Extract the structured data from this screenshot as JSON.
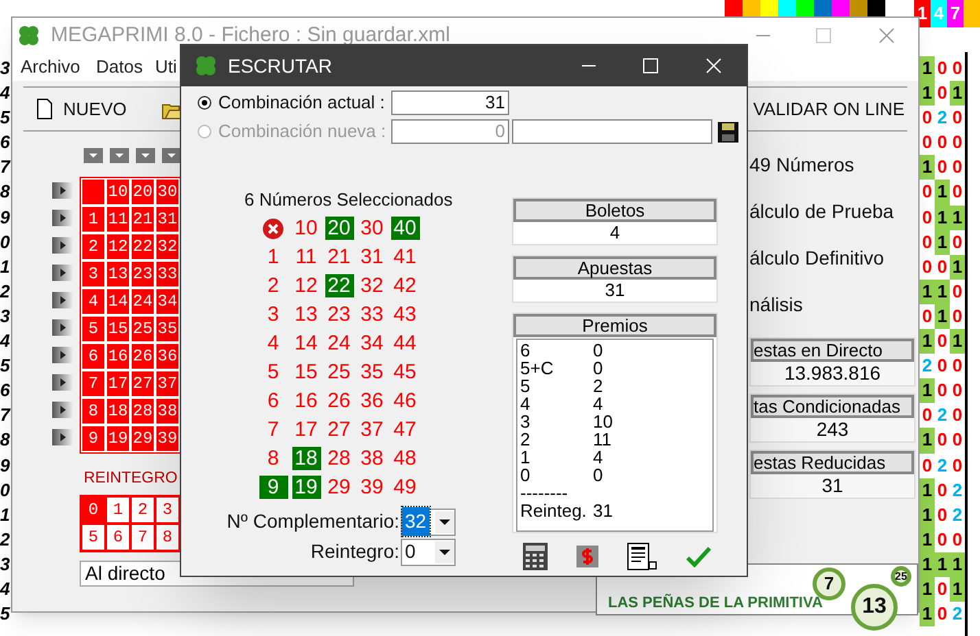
{
  "background": {
    "header_swatches": [
      {
        "color": "#ff0000"
      },
      {
        "color": "#ffc000"
      },
      {
        "color": "#ffff00"
      },
      {
        "color": "#00ffff"
      },
      {
        "color": "#00ff00"
      },
      {
        "color": "#0070c0"
      },
      {
        "color": "#ff00ff"
      },
      {
        "color": "#bf9000"
      },
      {
        "color": "#000000"
      }
    ],
    "corner_cells": [
      {
        "text": "1",
        "color": "#ff0000"
      },
      {
        "text": "4",
        "color": "#00ffff"
      },
      {
        "text": "7",
        "color": "#ff00ff"
      },
      {
        "color": "#ffc000"
      }
    ],
    "row_numbers": [
      "3",
      "4",
      "5",
      "6",
      "7",
      "8",
      "9",
      "0",
      "1",
      "2",
      "3",
      "4",
      "5",
      "6",
      "7",
      "8",
      "9",
      "0",
      "1",
      "2",
      "3",
      "4",
      "5"
    ],
    "grid_rows": [
      [
        {
          "text": "1",
          "kind": "one"
        },
        {
          "text": "0",
          "kind": "zero"
        },
        {
          "text": "0",
          "kind": "zero"
        }
      ],
      [
        {
          "text": "1",
          "kind": "one"
        },
        {
          "text": "0",
          "kind": "zero"
        },
        {
          "text": "1",
          "kind": "one"
        }
      ],
      [
        {
          "text": "0",
          "kind": "zero"
        },
        {
          "text": "2",
          "kind": "two"
        },
        {
          "text": "0",
          "kind": "zero"
        }
      ],
      [
        {
          "text": "0",
          "kind": "zero"
        },
        {
          "text": "0",
          "kind": "zero"
        },
        {
          "text": "0",
          "kind": "zero"
        }
      ],
      [
        {
          "text": "1",
          "kind": "one"
        },
        {
          "text": "0",
          "kind": "zero"
        },
        {
          "text": "0",
          "kind": "zero"
        }
      ],
      [
        {
          "text": "0",
          "kind": "zero"
        },
        {
          "text": "1",
          "kind": "one"
        },
        {
          "text": "0",
          "kind": "zero"
        }
      ],
      [
        {
          "text": "0",
          "kind": "zero"
        },
        {
          "text": "1",
          "kind": "one"
        },
        {
          "text": "1",
          "kind": "one"
        }
      ],
      [
        {
          "text": "0",
          "kind": "zero"
        },
        {
          "text": "1",
          "kind": "one"
        },
        {
          "text": "0",
          "kind": "zero"
        }
      ],
      [
        {
          "text": "0",
          "kind": "zero"
        },
        {
          "text": "0",
          "kind": "zero"
        },
        {
          "text": "1",
          "kind": "one"
        }
      ],
      [
        {
          "text": "1",
          "kind": "one"
        },
        {
          "text": "1",
          "kind": "one"
        },
        {
          "text": "0",
          "kind": "zero"
        }
      ],
      [
        {
          "text": "0",
          "kind": "zero"
        },
        {
          "text": "1",
          "kind": "one"
        },
        {
          "text": "0",
          "kind": "zero"
        }
      ],
      [
        {
          "text": "1",
          "kind": "one"
        },
        {
          "text": "0",
          "kind": "zero"
        },
        {
          "text": "1",
          "kind": "one"
        }
      ],
      [
        {
          "text": "2",
          "kind": "two"
        },
        {
          "text": "0",
          "kind": "zero"
        },
        {
          "text": "0",
          "kind": "zero"
        }
      ],
      [
        {
          "text": "1",
          "kind": "one"
        },
        {
          "text": "0",
          "kind": "zero"
        },
        {
          "text": "0",
          "kind": "zero"
        }
      ],
      [
        {
          "text": "0",
          "kind": "zero"
        },
        {
          "text": "2",
          "kind": "two"
        },
        {
          "text": "0",
          "kind": "zero"
        }
      ],
      [
        {
          "text": "1",
          "kind": "one"
        },
        {
          "text": "0",
          "kind": "zero"
        },
        {
          "text": "0",
          "kind": "zero"
        }
      ],
      [
        {
          "text": "0",
          "kind": "zero"
        },
        {
          "text": "2",
          "kind": "two"
        },
        {
          "text": "0",
          "kind": "zero"
        }
      ],
      [
        {
          "text": "1",
          "kind": "one"
        },
        {
          "text": "0",
          "kind": "zero"
        },
        {
          "text": "2",
          "kind": "two"
        }
      ],
      [
        {
          "text": "1",
          "kind": "one"
        },
        {
          "text": "0",
          "kind": "zero"
        },
        {
          "text": "2",
          "kind": "two"
        }
      ],
      [
        {
          "text": "1",
          "kind": "one"
        },
        {
          "text": "0",
          "kind": "zero"
        },
        {
          "text": "0",
          "kind": "zero"
        }
      ],
      [
        {
          "text": "1",
          "kind": "one"
        },
        {
          "text": "1",
          "kind": "one"
        },
        {
          "text": "1",
          "kind": "one"
        }
      ],
      [
        {
          "text": "1",
          "kind": "one"
        },
        {
          "text": "0",
          "kind": "zero"
        },
        {
          "text": "1",
          "kind": "one"
        }
      ],
      [
        {
          "text": "1",
          "kind": "one"
        },
        {
          "text": "0",
          "kind": "zero"
        },
        {
          "text": "2",
          "kind": "two"
        }
      ]
    ]
  },
  "main_window": {
    "title": "MEGAPRIMI 8.0 - Fichero : Sin guardar.xml",
    "menu": [
      "Archivo",
      "Datos",
      "Uti"
    ],
    "toolbar": [
      {
        "kind": "new",
        "label": "NUEVO"
      },
      {
        "kind": "open"
      }
    ],
    "validate_label": "VALIDAR ON LINE",
    "number_grid": [
      [
        {
          "kind": "empty"
        },
        {
          "kind": "number",
          "text": "10"
        },
        {
          "kind": "number",
          "text": "20"
        },
        {
          "kind": "number",
          "text": "30"
        }
      ],
      [
        {
          "kind": "number",
          "text": "1"
        },
        {
          "kind": "number",
          "text": "11"
        },
        {
          "kind": "number",
          "text": "21"
        },
        {
          "kind": "number",
          "text": "31"
        }
      ],
      [
        {
          "kind": "number",
          "text": "2"
        },
        {
          "kind": "number",
          "text": "12"
        },
        {
          "kind": "number",
          "text": "22"
        },
        {
          "kind": "number",
          "text": "32"
        }
      ],
      [
        {
          "kind": "number",
          "text": "3"
        },
        {
          "kind": "number",
          "text": "13"
        },
        {
          "kind": "number",
          "text": "23"
        },
        {
          "kind": "number",
          "text": "33"
        }
      ],
      [
        {
          "kind": "number",
          "text": "4"
        },
        {
          "kind": "number",
          "text": "14"
        },
        {
          "kind": "number",
          "text": "24"
        },
        {
          "kind": "number",
          "text": "34"
        }
      ],
      [
        {
          "kind": "number",
          "text": "5"
        },
        {
          "kind": "number",
          "text": "15"
        },
        {
          "kind": "number",
          "text": "25"
        },
        {
          "kind": "number",
          "text": "35"
        }
      ],
      [
        {
          "kind": "number",
          "text": "6"
        },
        {
          "kind": "number",
          "text": "16"
        },
        {
          "kind": "number",
          "text": "26"
        },
        {
          "kind": "number",
          "text": "36"
        }
      ],
      [
        {
          "kind": "number",
          "text": "7"
        },
        {
          "kind": "number",
          "text": "17"
        },
        {
          "kind": "number",
          "text": "27"
        },
        {
          "kind": "number",
          "text": "37"
        }
      ],
      [
        {
          "kind": "number",
          "text": "8"
        },
        {
          "kind": "number",
          "text": "18"
        },
        {
          "kind": "number",
          "text": "28"
        },
        {
          "kind": "number",
          "text": "38"
        }
      ],
      [
        {
          "kind": "number",
          "text": "9"
        },
        {
          "kind": "number",
          "text": "19"
        },
        {
          "kind": "number",
          "text": "29"
        },
        {
          "kind": "number",
          "text": "39"
        }
      ]
    ],
    "reintegro": {
      "label": "REINTEGRO",
      "rows": [
        [
          {
            "text": "0",
            "selected": true
          },
          {
            "text": "1",
            "selected": false
          },
          {
            "text": "2",
            "selected": false
          },
          {
            "text": "3",
            "selected": false
          }
        ],
        [
          {
            "text": "5",
            "selected": false
          },
          {
            "text": "6",
            "selected": false
          },
          {
            "text": "7",
            "selected": false
          },
          {
            "text": "8",
            "selected": false
          }
        ]
      ]
    },
    "mode_select": "Al directo",
    "actions": [
      "49 Números",
      "álculo de Prueba",
      "álculo Definitivo",
      "nálisis"
    ],
    "stat_boxes": [
      {
        "label": "estas en Directo",
        "value": "13.983.816"
      },
      {
        "label": "tas Condicionadas",
        "value": "243"
      },
      {
        "label": "estas Reducidas",
        "value": "31"
      }
    ],
    "banner": {
      "tagline": "LAS PEÑAS DE LA PRIMITIVA",
      "balls": [
        "7",
        "13",
        "25"
      ]
    }
  },
  "dialog": {
    "title": "ESCRUTAR",
    "combination_options": [
      {
        "label": "Combinación actual :",
        "selected": true,
        "disabled": false,
        "value": "31"
      },
      {
        "label": "Combinación nueva :",
        "selected": false,
        "disabled": true,
        "value": "0"
      }
    ],
    "heading": "6 Números Seleccionados",
    "numbers": [
      [
        {
          "kind": "clear"
        },
        {
          "kind": "number",
          "text": "10",
          "selected": false
        },
        {
          "kind": "number",
          "text": "20",
          "selected": true
        },
        {
          "kind": "number",
          "text": "30",
          "selected": false
        },
        {
          "kind": "number",
          "text": "40",
          "selected": true
        }
      ],
      [
        {
          "kind": "number",
          "text": "1",
          "selected": false
        },
        {
          "kind": "number",
          "text": "11",
          "selected": false
        },
        {
          "kind": "number",
          "text": "21",
          "selected": false
        },
        {
          "kind": "number",
          "text": "31",
          "selected": false
        },
        {
          "kind": "number",
          "text": "41",
          "selected": false
        }
      ],
      [
        {
          "kind": "number",
          "text": "2",
          "selected": false
        },
        {
          "kind": "number",
          "text": "12",
          "selected": false
        },
        {
          "kind": "number",
          "text": "22",
          "selected": true
        },
        {
          "kind": "number",
          "text": "32",
          "selected": false
        },
        {
          "kind": "number",
          "text": "42",
          "selected": false
        }
      ],
      [
        {
          "kind": "number",
          "text": "3",
          "selected": false
        },
        {
          "kind": "number",
          "text": "13",
          "selected": false
        },
        {
          "kind": "number",
          "text": "23",
          "selected": false
        },
        {
          "kind": "number",
          "text": "33",
          "selected": false
        },
        {
          "kind": "number",
          "text": "43",
          "selected": false
        }
      ],
      [
        {
          "kind": "number",
          "text": "4",
          "selected": false
        },
        {
          "kind": "number",
          "text": "14",
          "selected": false
        },
        {
          "kind": "number",
          "text": "24",
          "selected": false
        },
        {
          "kind": "number",
          "text": "34",
          "selected": false
        },
        {
          "kind": "number",
          "text": "44",
          "selected": false
        }
      ],
      [
        {
          "kind": "number",
          "text": "5",
          "selected": false
        },
        {
          "kind": "number",
          "text": "15",
          "selected": false
        },
        {
          "kind": "number",
          "text": "25",
          "selected": false
        },
        {
          "kind": "number",
          "text": "35",
          "selected": false
        },
        {
          "kind": "number",
          "text": "45",
          "selected": false
        }
      ],
      [
        {
          "kind": "number",
          "text": "6",
          "selected": false
        },
        {
          "kind": "number",
          "text": "16",
          "selected": false
        },
        {
          "kind": "number",
          "text": "26",
          "selected": false
        },
        {
          "kind": "number",
          "text": "36",
          "selected": false
        },
        {
          "kind": "number",
          "text": "46",
          "selected": false
        }
      ],
      [
        {
          "kind": "number",
          "text": "7",
          "selected": false
        },
        {
          "kind": "number",
          "text": "17",
          "selected": false
        },
        {
          "kind": "number",
          "text": "27",
          "selected": false
        },
        {
          "kind": "number",
          "text": "37",
          "selected": false
        },
        {
          "kind": "number",
          "text": "47",
          "selected": false
        }
      ],
      [
        {
          "kind": "number",
          "text": "8",
          "selected": false
        },
        {
          "kind": "number",
          "text": "18",
          "selected": true
        },
        {
          "kind": "number",
          "text": "28",
          "selected": false
        },
        {
          "kind": "number",
          "text": "38",
          "selected": false
        },
        {
          "kind": "number",
          "text": "48",
          "selected": false
        }
      ],
      [
        {
          "kind": "number",
          "text": "9",
          "selected": true
        },
        {
          "kind": "number",
          "text": "19",
          "selected": true
        },
        {
          "kind": "number",
          "text": "29",
          "selected": false
        },
        {
          "kind": "number",
          "text": "39",
          "selected": false
        },
        {
          "kind": "number",
          "text": "49",
          "selected": false
        }
      ]
    ],
    "counters": [
      {
        "label": "Boletos",
        "value": "4"
      },
      {
        "label": "Apuestas",
        "value": "31"
      }
    ],
    "prizes": {
      "label": "Premios",
      "rows": [
        [
          "6",
          "0"
        ],
        [
          "5+C",
          "0"
        ],
        [
          "5",
          "2"
        ],
        [
          "4",
          "4"
        ],
        [
          "3",
          "10"
        ],
        [
          "2",
          "11"
        ],
        [
          "1",
          "4"
        ],
        [
          "0",
          "0"
        ]
      ],
      "separator": "--------",
      "total": [
        "Reinteg.",
        "31"
      ]
    },
    "complementario": {
      "label": "Nº Complementario:",
      "value": "32"
    },
    "reintegro": {
      "label": "Reintegro:",
      "value": "0"
    }
  }
}
